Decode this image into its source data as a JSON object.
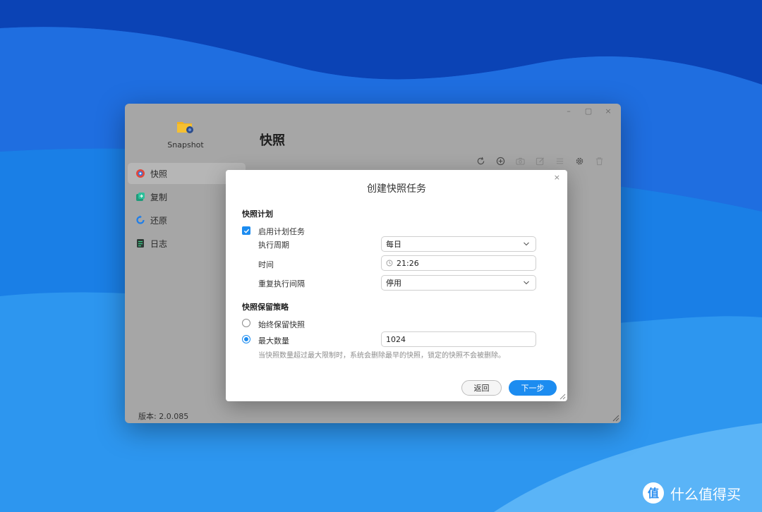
{
  "window": {
    "controls": [
      "–",
      "▢",
      "×"
    ]
  },
  "sidebar": {
    "app_name": "Snapshot",
    "items": [
      {
        "label": "快照",
        "icon": "snapshot-icon",
        "active": true
      },
      {
        "label": "复制",
        "icon": "replicate-icon",
        "active": false
      },
      {
        "label": "还原",
        "icon": "restore-icon",
        "active": false
      },
      {
        "label": "日志",
        "icon": "log-icon",
        "active": false
      }
    ],
    "version": "版本: 2.0.085"
  },
  "main": {
    "title": "快照",
    "toolbar_icons": [
      "refresh-icon",
      "add-icon",
      "camera-icon",
      "edit-icon",
      "list-icon",
      "settings-icon",
      "delete-icon"
    ]
  },
  "dialog": {
    "title": "创建快照任务",
    "close": "×",
    "schedule_section": "快照计划",
    "enable_schedule_label": "启用计划任务",
    "enable_schedule_checked": true,
    "period_label": "执行周期",
    "period_value": "每日",
    "time_label": "时间",
    "time_value": "21:26",
    "repeat_label": "重复执行间隔",
    "repeat_value": "停用",
    "retention_section": "快照保留策略",
    "keep_always_label": "始终保留快照",
    "max_count_label": "最大数量",
    "max_count_value": "1024",
    "selected_retention": "max_count",
    "hint": "当快照数量超过最大限制时，系统会删除最早的快照，锁定的快照不会被删除。",
    "back_button": "返回",
    "next_button": "下一步"
  },
  "watermark": {
    "text": "什么值得买",
    "badge": "值"
  },
  "colors": {
    "accent": "#1c8cf0",
    "background_blue": "#1f6fe0"
  }
}
